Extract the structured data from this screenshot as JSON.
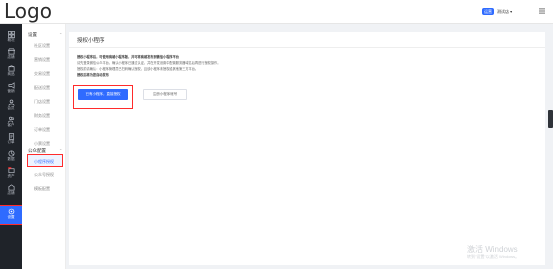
{
  "header": {
    "logo": "Logo",
    "badge": "运营",
    "user": "测试店 ▾"
  },
  "rail": [
    {
      "label": "概况",
      "icon": "grid-icon"
    },
    {
      "label": "店铺",
      "icon": "store-icon"
    },
    {
      "label": "商品",
      "icon": "box-icon"
    },
    {
      "label": "营销",
      "icon": "megaphone-icon"
    },
    {
      "label": "会员",
      "icon": "user-icon"
    },
    {
      "label": "客户",
      "icon": "users-icon"
    },
    {
      "label": "订单",
      "icon": "order-icon"
    },
    {
      "label": "数据",
      "icon": "chart-icon"
    },
    {
      "label": "资产",
      "icon": "wallet-icon"
    },
    {
      "label": "店铺",
      "icon": "shop-icon"
    },
    {
      "label": "设置",
      "icon": "gear-icon"
    }
  ],
  "subnav": {
    "group1": "设置",
    "items1": [
      "社区设置",
      "营销设置",
      "交易设置",
      "配送设置",
      "门店设置",
      "财务设置",
      "订单设置",
      "小票设置"
    ],
    "group2": "公众配置",
    "items2": [
      "小程序授权",
      "公众号授权",
      "模板配置"
    ]
  },
  "panel": {
    "title": "授权小程序",
    "desc1": "授权小程序后，可使用商城小程序版，并可将商城发布到微信小程序平台",
    "desc2": "请先登录微信公众平台，确认小程序已通过认证，并在开发设置中配置服务器域名后再进行授权操作。",
    "desc3": "授权前请确认：小程序管理员已扫码确认授权，且该小程序未授权给其他第三方平台。",
    "desc4": "授权后将为您自动发布",
    "primary_btn": "已有小程序，直接授权",
    "outline_btn": "注册小程序帐号"
  },
  "watermark": {
    "line1": "激活 Windows",
    "line2": "转到\"设置\"以激活 Windows。"
  }
}
